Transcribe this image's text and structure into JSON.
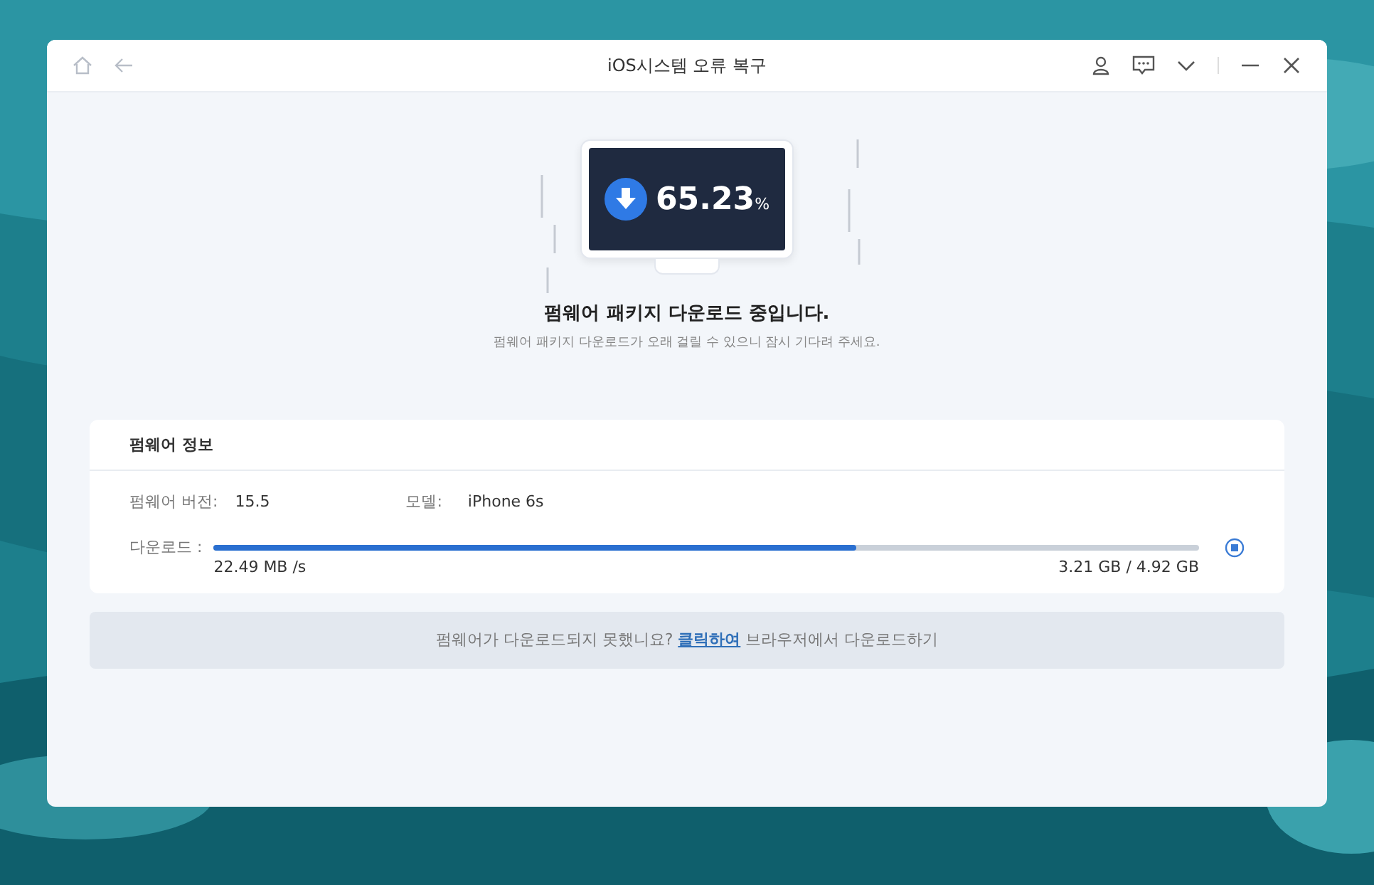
{
  "window": {
    "title": "iOS시스템 오류 복구"
  },
  "progress": {
    "value": "65.23",
    "unit": "%"
  },
  "status": {
    "heading": "펌웨어 패키지 다운로드 중입니다.",
    "note": "펌웨어 패키지 다운로드가 오래 걸릴 수 있으니 잠시 기다려 주세요."
  },
  "firmware_info": {
    "title": "펌웨어 정보",
    "version_label": "펌웨어 버전:",
    "version": "15.5",
    "model_label": "모델:",
    "model": "iPhone 6s",
    "download_label": "다운로드 :",
    "level": 0.6523,
    "speed": "22.49 MB /s",
    "size": "3.21 GB / 4.92 GB"
  },
  "footer": {
    "before": "펌웨어가 다운로드되지 못했니요?",
    "link": "클릭하여",
    "after": "브라우저에서 다운로드하기"
  }
}
